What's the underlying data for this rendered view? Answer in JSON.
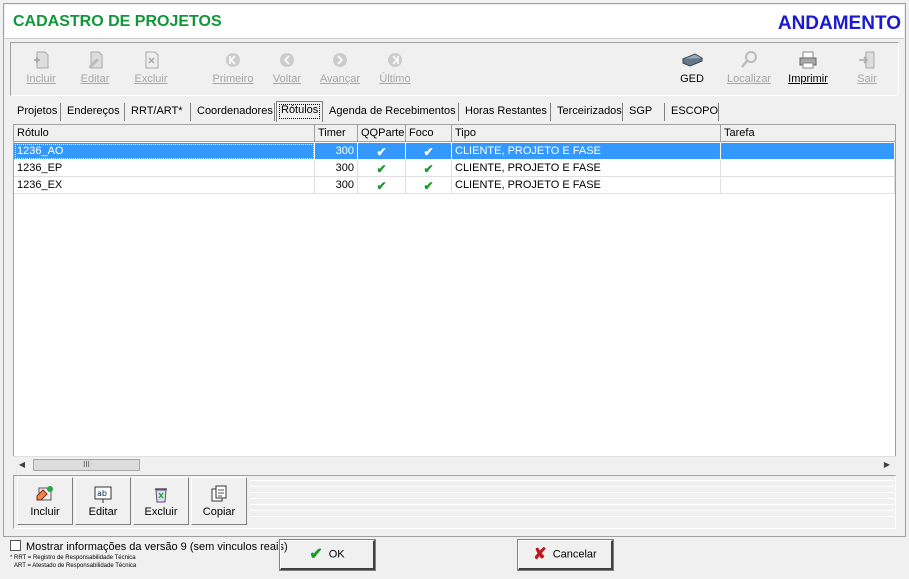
{
  "header": {
    "title": "CADASTRO DE PROJETOS",
    "status": "ANDAMENTO"
  },
  "toolbar": {
    "incluir": "Incluir",
    "editar": "Editar",
    "excluir": "Excluir",
    "primeiro": "Primeiro",
    "voltar": "Voltar",
    "avancar": "Avançar",
    "ultimo": "Último",
    "ged": "GED",
    "localizar": "Localizar",
    "imprimir": "Imprimir",
    "sair": "Sair"
  },
  "tabs": [
    "Projetos",
    "Endereços",
    "RRT/ART*",
    "Coordenadores",
    "Rótulos",
    "Agenda de Recebimentos",
    "Horas Restantes",
    "Terceirizados",
    "SGP",
    "ESCOPO"
  ],
  "grid": {
    "columns": [
      "Rótulo",
      "Timer",
      "QQParte",
      "Foco",
      "Tipo",
      "Tarefa"
    ],
    "rows": [
      {
        "rotulo": "1236_AO",
        "timer": "300",
        "tipo": "CLIENTE, PROJETO E FASE",
        "tarefa": ""
      },
      {
        "rotulo": "1236_EP",
        "timer": "300",
        "tipo": "CLIENTE, PROJETO E FASE",
        "tarefa": ""
      },
      {
        "rotulo": "1236_EX",
        "timer": "300",
        "tipo": "CLIENTE, PROJETO E FASE",
        "tarefa": ""
      }
    ],
    "check_glyph": "✔"
  },
  "actions": {
    "incluir": "Incluir",
    "editar": "Editar",
    "excluir": "Excluir",
    "copiar": "Copiar"
  },
  "footer": {
    "checkbox_label": "Mostrar informações da versão 9 (sem vinculos reais)",
    "note_rrt": "* RRT = Registro de Responsabilidade Técnica",
    "note_art": "ART = Atestado de Responsabilidade Técnica",
    "ok": "OK",
    "cancel": "Cancelar"
  },
  "colors": {
    "title": "#12963a",
    "status": "#1a1ad0",
    "selection": "#3399ff",
    "check": "#1a9a2a",
    "cancel_x": "#c0181c"
  }
}
